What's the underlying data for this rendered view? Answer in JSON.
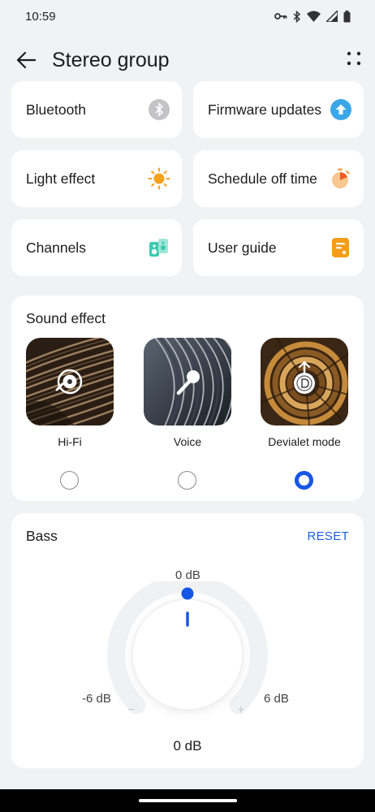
{
  "status_bar": {
    "time": "10:59",
    "icons": [
      "key-icon",
      "bluetooth-icon",
      "wifi-icon",
      "signal-icon",
      "battery-icon"
    ]
  },
  "app_bar": {
    "title": "Stereo group",
    "back_icon": "arrow-left-icon",
    "more_icon": "more-dots-icon"
  },
  "tiles": [
    {
      "label": "Bluetooth",
      "icon": "bluetooth-icon",
      "color": "#c4c4c6"
    },
    {
      "label": "Firmware updates",
      "icon": "upload-icon",
      "color": "#3ba6e8"
    },
    {
      "label": "Light effect",
      "icon": "sun-icon",
      "color": "#f7a21b"
    },
    {
      "label": "Schedule off time",
      "icon": "timer-icon",
      "color": "#f4a04a"
    },
    {
      "label": "Channels",
      "icon": "speakers-icon",
      "color": "#3cc9b0"
    },
    {
      "label": "User guide",
      "icon": "document-icon",
      "color": "#f59c1a"
    }
  ],
  "sound_effect": {
    "title": "Sound effect",
    "options": [
      {
        "label": "Hi-Fi",
        "icon": "vinyl-icon",
        "selected": false
      },
      {
        "label": "Voice",
        "icon": "microphone-icon",
        "selected": false
      },
      {
        "label": "Devialet mode",
        "icon": "devialet-logo-icon",
        "selected": true
      }
    ]
  },
  "bass": {
    "title": "Bass",
    "reset_label": "RESET",
    "min_label": "-6 dB",
    "max_label": "6 dB",
    "top_label": "0 dB",
    "value_label": "0 dB",
    "value_db": 0,
    "min_db": -6,
    "max_db": 6,
    "minus_symbol": "−",
    "plus_symbol": "+"
  },
  "colors": {
    "accent": "#1756e6",
    "background": "#f1f2f4",
    "card": "#ffffff"
  }
}
